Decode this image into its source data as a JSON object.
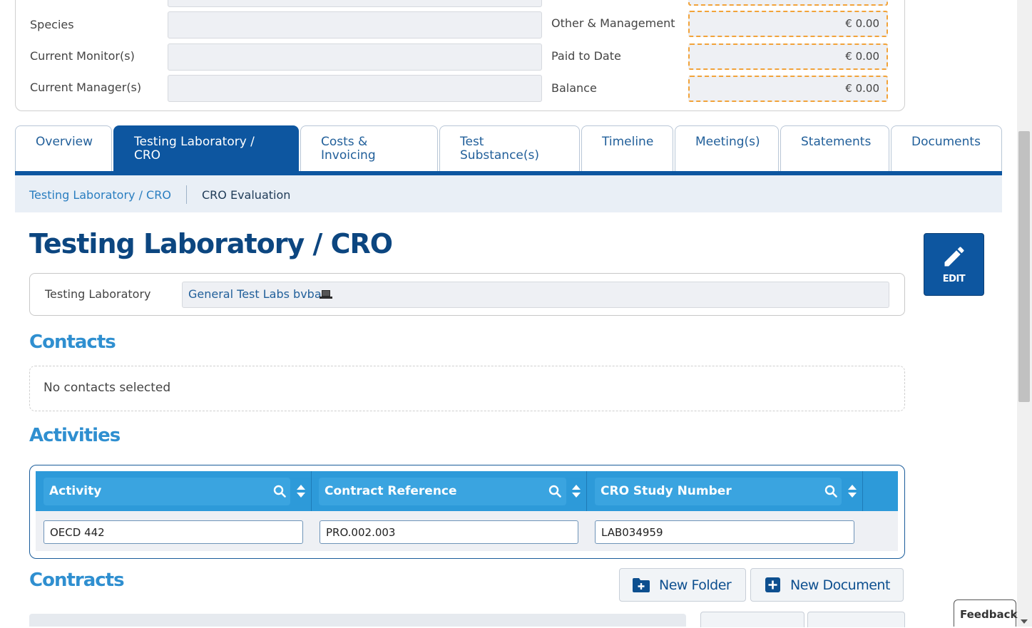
{
  "summary": {
    "left_fields": [
      {
        "label": "Species",
        "value": ""
      },
      {
        "label": "Current Monitor(s)",
        "value": ""
      },
      {
        "label": "Current Manager(s)",
        "value": ""
      }
    ],
    "right_fields": [
      {
        "label": "Other & Management",
        "value": "€ 0.00"
      },
      {
        "label": "Paid to Date",
        "value": "€ 0.00"
      },
      {
        "label": "Balance",
        "value": "€ 0.00"
      }
    ]
  },
  "tabs": [
    {
      "label": "Overview"
    },
    {
      "label": "Testing Laboratory / CRO"
    },
    {
      "label": "Costs & Invoicing"
    },
    {
      "label": "Test Substance(s)"
    },
    {
      "label": "Timeline"
    },
    {
      "label": "Meeting(s)"
    },
    {
      "label": "Statements"
    },
    {
      "label": "Documents"
    }
  ],
  "subnav": {
    "items": [
      "Testing Laboratory / CRO",
      "CRO Evaluation"
    ]
  },
  "page_title": "Testing Laboratory / CRO",
  "edit_label": "EDIT",
  "lab": {
    "label": "Testing Laboratory",
    "value": "General Test Labs bvba"
  },
  "contacts": {
    "title": "Contacts",
    "empty_text": "No contacts selected"
  },
  "activities": {
    "title": "Activities",
    "columns": [
      "Activity",
      "Contract Reference",
      "CRO Study Number"
    ],
    "rows": [
      [
        "OECD 442",
        "PRO.002.003",
        "LAB034959"
      ]
    ]
  },
  "contracts": {
    "title": "Contracts",
    "new_folder": "New Folder",
    "new_document": "New Document"
  },
  "feedback_label": "Feedback",
  "colors": {
    "primary": "#0d56a0",
    "accent": "#2f8fd0",
    "money_border": "#f2a33a"
  }
}
